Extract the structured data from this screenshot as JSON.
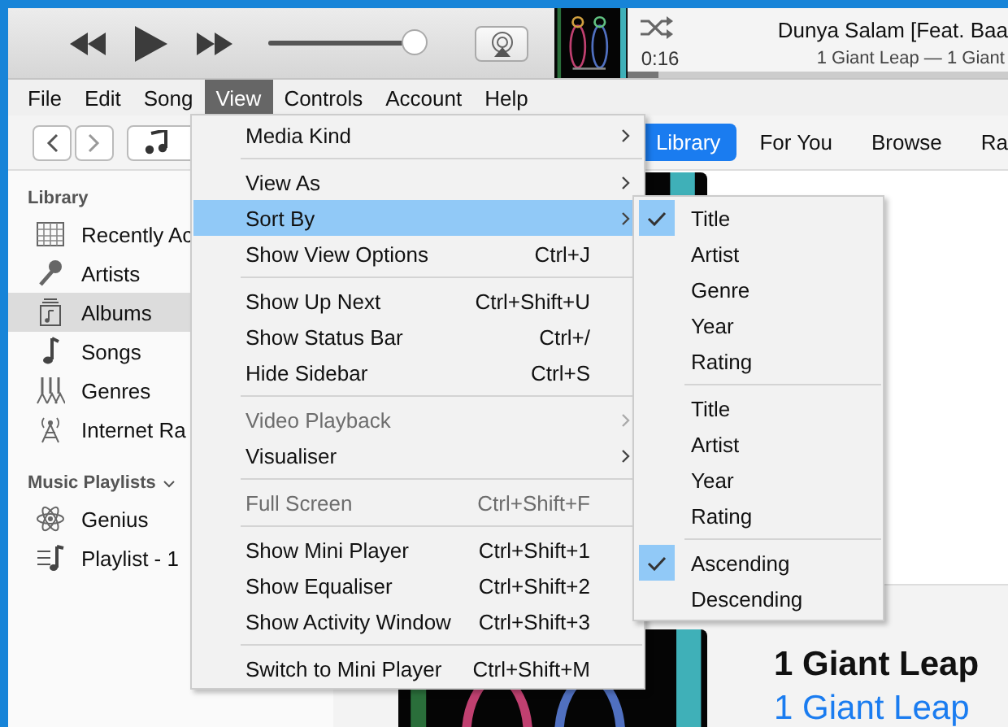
{
  "toolbar": {
    "volume": {
      "level": 0.95
    },
    "now_playing": {
      "time": "0:16",
      "progress": {
        "level": 0.08
      },
      "title": "Dunya Salam [Feat. Baa",
      "subtitle": "1 Giant Leap — 1 Giant"
    }
  },
  "menu_bar": [
    {
      "label": "File",
      "selected": false
    },
    {
      "label": "Edit",
      "selected": false
    },
    {
      "label": "Song",
      "selected": false
    },
    {
      "label": "View",
      "selected": true
    },
    {
      "label": "Controls",
      "selected": false
    },
    {
      "label": "Account",
      "selected": false
    },
    {
      "label": "Help",
      "selected": false
    }
  ],
  "tabs": [
    {
      "label": "Library",
      "selected": true
    },
    {
      "label": "For You",
      "selected": false
    },
    {
      "label": "Browse",
      "selected": false
    },
    {
      "label": "Ra",
      "selected": false
    }
  ],
  "sidebar": {
    "sections": [
      {
        "title": "Library",
        "collapsible": false,
        "items": [
          {
            "label": "Recently Ac",
            "selected": false
          },
          {
            "label": "Artists",
            "selected": false
          },
          {
            "label": "Albums",
            "selected": true
          },
          {
            "label": "Songs",
            "selected": false
          },
          {
            "label": "Genres",
            "selected": false
          },
          {
            "label": "Internet Ra",
            "selected": false
          }
        ]
      },
      {
        "title": "Music Playlists",
        "collapsible": true,
        "items": [
          {
            "label": "Genius",
            "selected": false
          },
          {
            "label": "Playlist - 1",
            "selected": false
          }
        ]
      }
    ]
  },
  "album": {
    "artist": "1 Giant Leap",
    "title": "1 Giant Leap"
  },
  "view_menu": {
    "items": [
      {
        "kind": "item",
        "label": "Media Kind",
        "submenu": true,
        "selected": false,
        "disabled": false
      },
      {
        "kind": "separator"
      },
      {
        "kind": "item",
        "label": "View As",
        "submenu": true,
        "selected": false,
        "disabled": false
      },
      {
        "kind": "item",
        "label": "Sort By",
        "submenu": true,
        "selected": true,
        "disabled": false
      },
      {
        "kind": "item",
        "label": "Show View Options",
        "shortcut": "Ctrl+J",
        "selected": false,
        "disabled": false
      },
      {
        "kind": "separator"
      },
      {
        "kind": "item",
        "label": "Show Up Next",
        "shortcut": "Ctrl+Shift+U",
        "selected": false,
        "disabled": false
      },
      {
        "kind": "item",
        "label": "Show Status Bar",
        "shortcut": "Ctrl+/",
        "selected": false,
        "disabled": false
      },
      {
        "kind": "item",
        "label": "Hide Sidebar",
        "shortcut": "Ctrl+S",
        "selected": false,
        "disabled": false
      },
      {
        "kind": "separator"
      },
      {
        "kind": "item",
        "label": "Video Playback",
        "submenu": true,
        "selected": false,
        "disabled": true
      },
      {
        "kind": "item",
        "label": "Visualiser",
        "submenu": true,
        "selected": false,
        "disabled": false
      },
      {
        "kind": "separator"
      },
      {
        "kind": "item",
        "label": "Full Screen",
        "shortcut": "Ctrl+Shift+F",
        "selected": false,
        "disabled": true
      },
      {
        "kind": "separator"
      },
      {
        "kind": "item",
        "label": "Show Mini Player",
        "shortcut": "Ctrl+Shift+1",
        "selected": false,
        "disabled": false
      },
      {
        "kind": "item",
        "label": "Show Equaliser",
        "shortcut": "Ctrl+Shift+2",
        "selected": false,
        "disabled": false
      },
      {
        "kind": "item",
        "label": "Show Activity Window",
        "shortcut": "Ctrl+Shift+3",
        "selected": false,
        "disabled": false
      },
      {
        "kind": "separator"
      },
      {
        "kind": "item",
        "label": "Switch to Mini Player",
        "shortcut": "Ctrl+Shift+M",
        "selected": false,
        "disabled": false
      }
    ]
  },
  "sort_menu": {
    "items": [
      {
        "kind": "item",
        "label": "Title",
        "checked": true
      },
      {
        "kind": "item",
        "label": "Artist",
        "checked": false
      },
      {
        "kind": "item",
        "label": "Genre",
        "checked": false
      },
      {
        "kind": "item",
        "label": "Year",
        "checked": false
      },
      {
        "kind": "item",
        "label": "Rating",
        "checked": false
      },
      {
        "kind": "separator"
      },
      {
        "kind": "item",
        "label": "Title",
        "checked": false
      },
      {
        "kind": "item",
        "label": "Artist",
        "checked": false
      },
      {
        "kind": "item",
        "label": "Year",
        "checked": false
      },
      {
        "kind": "item",
        "label": "Rating",
        "checked": false
      },
      {
        "kind": "separator"
      },
      {
        "kind": "item",
        "label": "Ascending",
        "checked": true
      },
      {
        "kind": "item",
        "label": "Descending",
        "checked": false
      }
    ]
  }
}
